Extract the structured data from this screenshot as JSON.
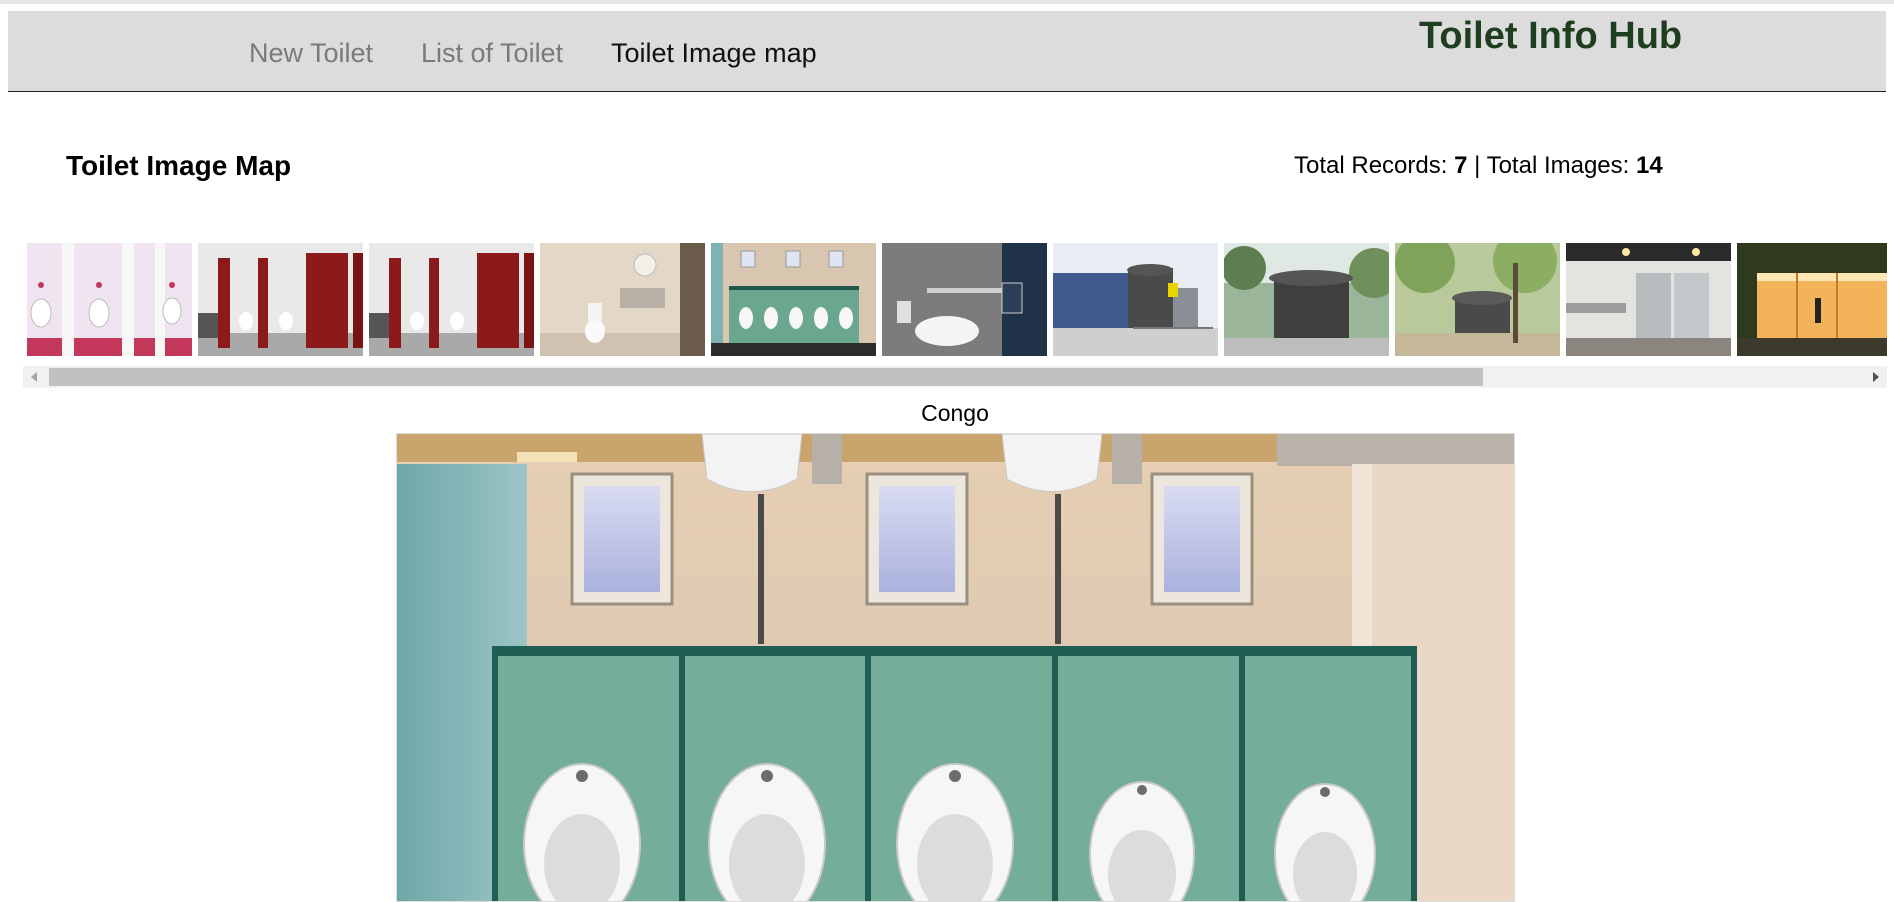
{
  "nav": {
    "links": [
      "New Toilet",
      "List of Toilet",
      "Toilet Image map"
    ],
    "active_index": 2,
    "brand": "Toilet Info Hub"
  },
  "page": {
    "title": "Toilet Image Map",
    "stats": {
      "records_label": "Total Records: ",
      "records_value": "7",
      "separator": " | ",
      "images_label": "Total Images: ",
      "images_value": "14"
    }
  },
  "gallery": {
    "thumbnails": [
      "pink-stalls-photo",
      "red-stalls-photo",
      "red-stalls-photo",
      "beige-restroom-photo",
      "green-urinals-photo",
      "accessible-toilet-photo",
      "container-toilet-photo",
      "round-pavilion-photo",
      "park-pavilion-photo",
      "grey-stalls-photo",
      "glass-toilet-photo"
    ],
    "scroll_fraction": 0.77
  },
  "viewer": {
    "caption": "Congo",
    "image": "green-urinals-photo"
  },
  "colors": {
    "navbar_bg": "#dcdcdc",
    "brand": "#1f3d1f",
    "nav_inactive": "#7a7a7a",
    "nav_active": "#111111"
  }
}
